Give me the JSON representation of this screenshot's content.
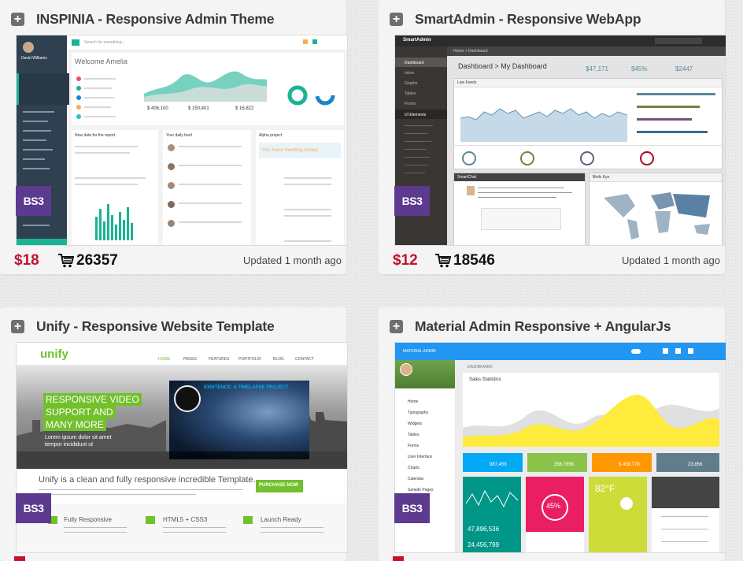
{
  "cards": [
    {
      "title": "INSPINIA - Responsive Admin Theme",
      "price": "$18",
      "sales": "26357",
      "updated": "Updated 1 month ago",
      "badge": "BS3",
      "preview": {
        "welcome": "Welcome Amelia",
        "user": "David Williams",
        "stats": [
          "$ 406,100",
          "$ 150,401",
          "$ 16,822"
        ],
        "sections": [
          "New data for the report",
          "Your daily feed",
          "Alpha project"
        ],
        "meeting": "You have meeting today!",
        "search": "Search for something..."
      }
    },
    {
      "title": "SmartAdmin - Responsive WebApp",
      "price": "$12",
      "sales": "18546",
      "updated": "Updated 1 month ago",
      "badge": "BS3",
      "preview": {
        "brand": "SmartAdmin",
        "crumb": "Home > Dashboard",
        "heading": "Dashboard > My Dashboard",
        "stats": [
          "$47,171",
          "$45%",
          "$2447"
        ],
        "panel1": "Live Feeds",
        "panel2": "SmartChat",
        "panel3": "Birds Eye",
        "nav": [
          "Dashboard",
          "Inbox",
          "Graphs",
          "Tables",
          "Forms",
          "UI Elements"
        ]
      }
    },
    {
      "title": "Unify - Responsive Website Template",
      "price": "",
      "sales": "",
      "updated": "",
      "badge": "BS3",
      "preview": {
        "logo": "unify",
        "nav": [
          "HOME",
          "PAGES",
          "FEATURES",
          "PORTFOLIO",
          "BLOG",
          "CONTACT"
        ],
        "hero_lines": [
          "RESPONSIVE VIDEO",
          "SUPPORT AND",
          "MANY MORE"
        ],
        "hero_sub": "Lorem ipsum dolor sit amet tempor incididunt ut",
        "video_title": "EXISTENCE: A TIMELAPSE PROJECT",
        "tagline": "Unify is a clean and fully responsive incredible Template.",
        "cta": "PURCHASE NOW",
        "features": [
          "Fully Responsive",
          "HTML5 + CSS3",
          "Launch Ready"
        ]
      }
    },
    {
      "title": "Material Admin Responsive + AngularJs",
      "price": "",
      "sales": "",
      "updated": "",
      "badge": "BS3",
      "preview": {
        "brand": "MATERIAL ADMIN",
        "section": "DASHBOARD",
        "chart_title": "Sales Statistics",
        "tiles": [
          "987,459",
          "356,785K",
          "$ 458,778",
          "23,856"
        ],
        "temp": "82°F",
        "percent": "45%",
        "numbers": [
          "47,896,536",
          "24,456,799"
        ],
        "nav": [
          "Home",
          "Typography",
          "Widgets",
          "Tables",
          "Forms",
          "User Interface",
          "Charts",
          "Calendar",
          "Sample Pages"
        ]
      }
    }
  ]
}
